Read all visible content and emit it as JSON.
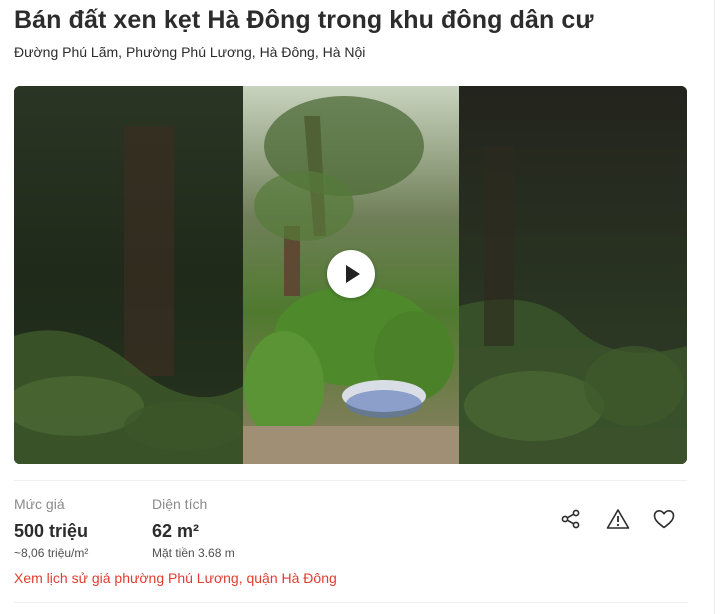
{
  "listing": {
    "title": "Bán đất xen kẹt Hà Đông trong khu đông dân cư",
    "address": "Đường Phú Lãm, Phường Phú Lương, Hà Đông, Hà Nội"
  },
  "media": {
    "type": "video",
    "play_icon": "play-icon"
  },
  "price": {
    "label": "Mức giá",
    "value": "500 triệu",
    "per_m2": "~8,06 triệu/m²"
  },
  "area": {
    "label": "Diện tích",
    "value": "62 m²",
    "frontage": "Mặt tiền 3.68 m"
  },
  "actions": {
    "share_icon": "share-icon",
    "report_icon": "warning-icon",
    "favorite_icon": "heart-icon"
  },
  "history_link": "Xem lịch sử giá phường Phú Lương, quận Hà Đông",
  "colors": {
    "link": "#e03c31",
    "text": "#2c2c2c",
    "muted": "#8a8a8a"
  }
}
